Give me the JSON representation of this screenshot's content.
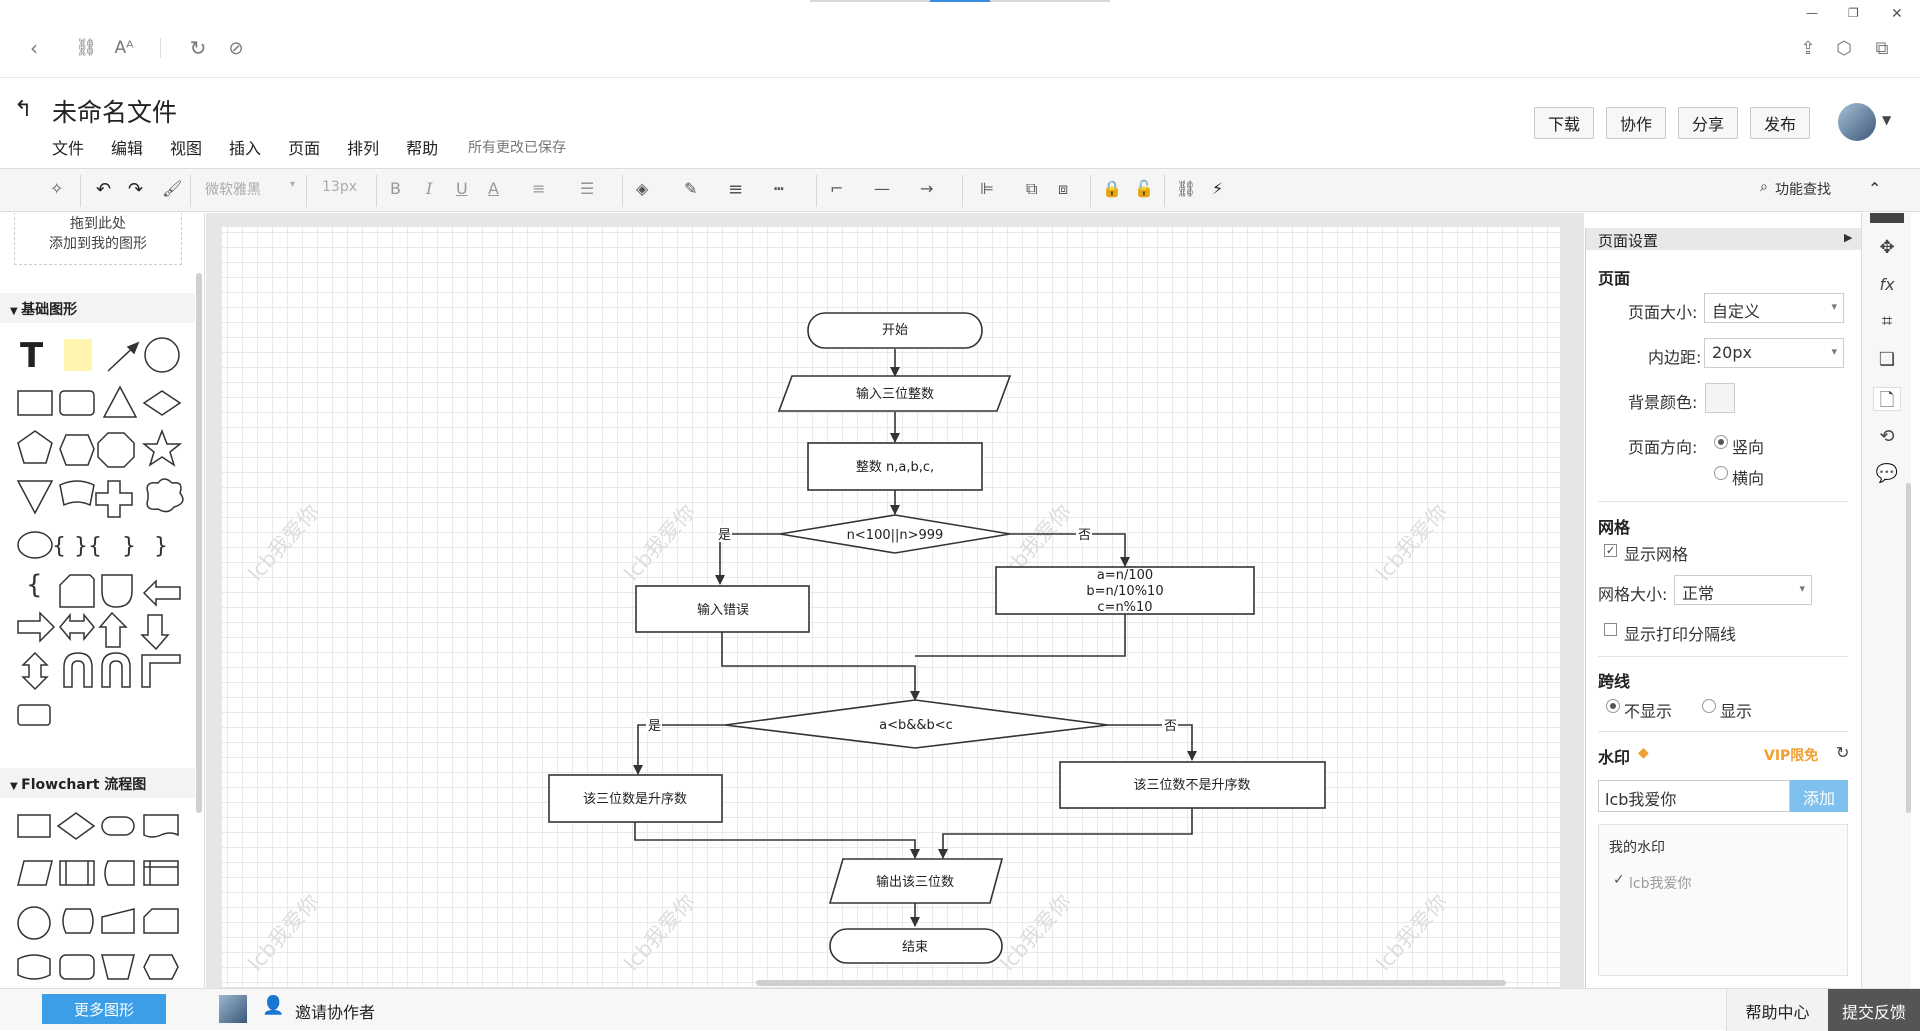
{
  "document": {
    "title": "未命名文件",
    "save_status": "所有更改已保存"
  },
  "menu": [
    "文件",
    "编辑",
    "视图",
    "插入",
    "页面",
    "排列",
    "帮助"
  ],
  "header_buttons": {
    "download": "下载",
    "collaborate": "协作",
    "share": "分享",
    "publish": "发布"
  },
  "toolbar": {
    "font_family": "微软雅黑",
    "font_size": "13px",
    "search": "功能查找"
  },
  "left_panel": {
    "drop_hint_line1": "拖到此处",
    "drop_hint_line2": "添加到我的图形",
    "section_basic": "基础图形",
    "section_flowchart": "Flowchart 流程图",
    "more_shapes": "更多图形"
  },
  "flowchart": {
    "start": "开始",
    "input": "输入三位整数",
    "declare": "整数 n,a,b,c,",
    "cond1": "n<100||n>999",
    "yes1": "是",
    "no1": "否",
    "error": "输入错误",
    "calc1": "a=n/100",
    "calc2": "b=n/10%10",
    "calc3": "c=n%10",
    "cond2": "a<b&&b<c",
    "yes2": "是",
    "no2": "否",
    "ascending": "该三位数是升序数",
    "not_ascending": "该三位数不是升序数",
    "output": "输出该三位数",
    "end": "结束"
  },
  "watermark_text": "lcb我爱你",
  "right_panel": {
    "title": "页面设置",
    "page_section": "页面",
    "page_size_label": "页面大小:",
    "page_size_value": "自定义",
    "padding_label": "内边距:",
    "padding_value": "20px",
    "bg_color_label": "背景颜色:",
    "orientation_label": "页面方向:",
    "orientation_portrait": "竖向",
    "orientation_landscape": "横向",
    "grid_section": "网格",
    "show_grid": "显示网格",
    "grid_size_label": "网格大小:",
    "grid_size_value": "正常",
    "show_print_sep": "显示打印分隔线",
    "jump_section": "跨线",
    "jump_hide": "不显示",
    "jump_show": "显示",
    "watermark_section": "水印",
    "vip_label": "VIP限免",
    "watermark_input": "lcb我爱你",
    "add_button": "添加",
    "my_watermark": "我的水印",
    "my_watermark_item": "lcb我爱你"
  },
  "bottom": {
    "invite": "邀请协作者",
    "help": "帮助中心",
    "feedback": "提交反馈"
  },
  "colors": {
    "accent": "#3c9ee6",
    "vip": "#f0a030"
  }
}
